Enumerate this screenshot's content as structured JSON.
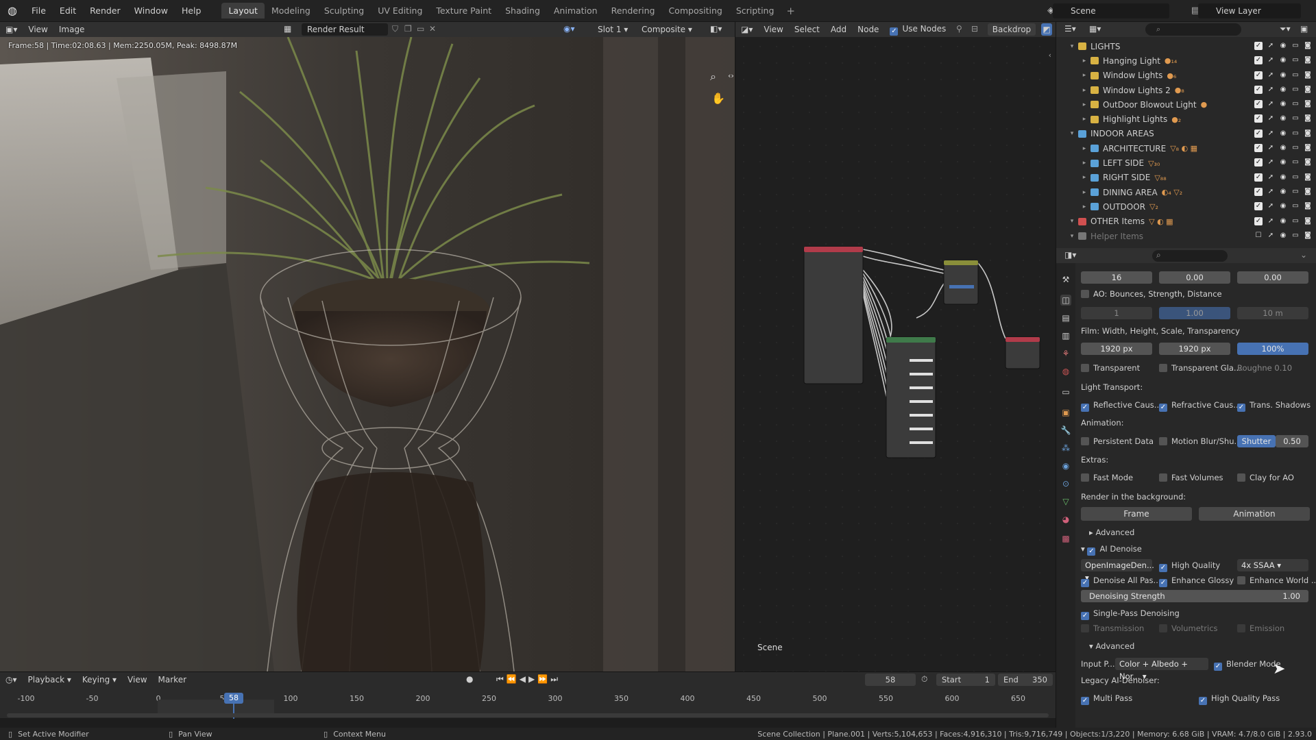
{
  "topbar": {
    "menus": [
      "File",
      "Edit",
      "Render",
      "Window",
      "Help"
    ],
    "workspaces": [
      "Layout",
      "Modeling",
      "Sculpting",
      "UV Editing",
      "Texture Paint",
      "Shading",
      "Animation",
      "Rendering",
      "Compositing",
      "Scripting"
    ],
    "plus": "+",
    "scene": "Scene",
    "view_layer": "View Layer"
  },
  "image_editor": {
    "menus": [
      "View",
      "Image"
    ],
    "image_name": "Render Result",
    "slot": "Slot 1",
    "layer": "Composite",
    "frame_info": "Frame:58 | Time:02:08.63 | Mem:2250.05M, Peak: 8498.87M"
  },
  "node_editor": {
    "menus": [
      "View",
      "Select",
      "Add",
      "Node"
    ],
    "use_nodes": "Use Nodes",
    "backdrop": "Backdrop",
    "scene_label": "Scene"
  },
  "outliner": {
    "rows": [
      {
        "name": "LIGHTS",
        "indent": 1,
        "color": "#d8b243",
        "icons": ""
      },
      {
        "name": "Hanging Light",
        "indent": 2,
        "color": "#d8b243",
        "icons": "●₁₄"
      },
      {
        "name": "Window Lights",
        "indent": 2,
        "color": "#d8b243",
        "icons": "●₆"
      },
      {
        "name": "Window Lights 2",
        "indent": 2,
        "color": "#d8b243",
        "icons": "●₈"
      },
      {
        "name": "OutDoor Blowout Light",
        "indent": 2,
        "color": "#d8b243",
        "icons": "●"
      },
      {
        "name": "Highlight Lights",
        "indent": 2,
        "color": "#d8b243",
        "icons": "●₂"
      },
      {
        "name": "INDOOR AREAS",
        "indent": 1,
        "color": "#5aa1d8",
        "icons": ""
      },
      {
        "name": "ARCHITECTURE",
        "indent": 2,
        "color": "#5aa1d8",
        "icons": "▽₈ ◐ ▦"
      },
      {
        "name": "LEFT SIDE",
        "indent": 2,
        "color": "#5aa1d8",
        "icons": "▽₃₀"
      },
      {
        "name": "RIGHT SIDE",
        "indent": 2,
        "color": "#5aa1d8",
        "icons": "▽₈₈"
      },
      {
        "name": "DINING AREA",
        "indent": 2,
        "color": "#5aa1d8",
        "icons": "◐₄ ▽₂"
      },
      {
        "name": "OUTDOOR",
        "indent": 2,
        "color": "#5aa1d8",
        "icons": "▽₂"
      },
      {
        "name": "OTHER Items",
        "indent": 1,
        "color": "#d05050",
        "icons": "▽ ◐ ▦"
      },
      {
        "name": "Helper Items",
        "indent": 1,
        "color": "#777777",
        "icons": ""
      }
    ]
  },
  "properties": {
    "f1": "16",
    "f2": "0.00",
    "f3": "0.00",
    "ao_label": "AO: Bounces, Strength, Distance",
    "ao1": "1",
    "ao2": "1.00",
    "ao3": "10 m",
    "film_label": "Film: Width, Height, Scale, Transparency",
    "film_w": "1920 px",
    "film_h": "1920 px",
    "film_scale": "100%",
    "transparent": "Transparent",
    "transparent_glass": "Transparent Gla...",
    "roughness": "Roughne",
    "roughness_val": "0.10",
    "light_transport": "Light Transport:",
    "reflective": "Reflective Caus...",
    "refractive": "Refractive Caus...",
    "trans_shadows": "Trans. Shadows",
    "animation": "Animation:",
    "persistent": "Persistent Data",
    "motion_blur": "Motion Blur/Shu...",
    "shutter": "Shutter",
    "shutter_val": "0.50",
    "extras": "Extras:",
    "fast_mode": "Fast Mode",
    "fast_volumes": "Fast Volumes",
    "clay_ao": "Clay for AO",
    "render_bg": "Render in the background:",
    "frame_btn": "Frame",
    "animation_btn": "Animation",
    "advanced": "Advanced",
    "ai_denoise": "AI Denoise",
    "denoiser": "OpenImageDen...",
    "high_quality": "High Quality",
    "ssaa": "4x SSAA",
    "denoise_all": "Denoise All Pas...",
    "enhance_glossy": "Enhance Glossy",
    "enhance_world": "Enhance World ...",
    "denoising_strength": "Denoising Strength",
    "denoising_val": "1.00",
    "single_pass": "Single-Pass Denoising",
    "transmission": "Transmission",
    "volumetrics": "Volumetrics",
    "emission": "Emission",
    "advanced2": "Advanced",
    "input_p": "Input P...",
    "input_val": "Color + Albedo + Nor...",
    "blender_mode": "Blender Mode",
    "legacy": "Legacy AI-Denoiser:",
    "multi_pass": "Multi Pass",
    "hq_pass": "High Quality Pass"
  },
  "timeline": {
    "menus": [
      "Playback",
      "Keying",
      "View",
      "Marker"
    ],
    "current_frame": "58",
    "start_label": "Start",
    "start": "1",
    "end_label": "End",
    "end": "350",
    "ticks": [
      "-100",
      "-50",
      "0",
      "50",
      "100",
      "150",
      "200",
      "250",
      "300",
      "350",
      "400",
      "450",
      "500",
      "550",
      "600",
      "650"
    ],
    "playhead": "58"
  },
  "statusbar": {
    "left": "Set Active Modifier",
    "mid": "Pan View",
    "ctx": "Context Menu",
    "stats": "Scene Collection | Plane.001 | Verts:5,104,653 | Faces:4,916,310 | Tris:9,716,749 | Objects:1/3,220 | Memory: 6.68 GiB | VRAM: 4.7/8.0 GiB | 2.93.0"
  }
}
